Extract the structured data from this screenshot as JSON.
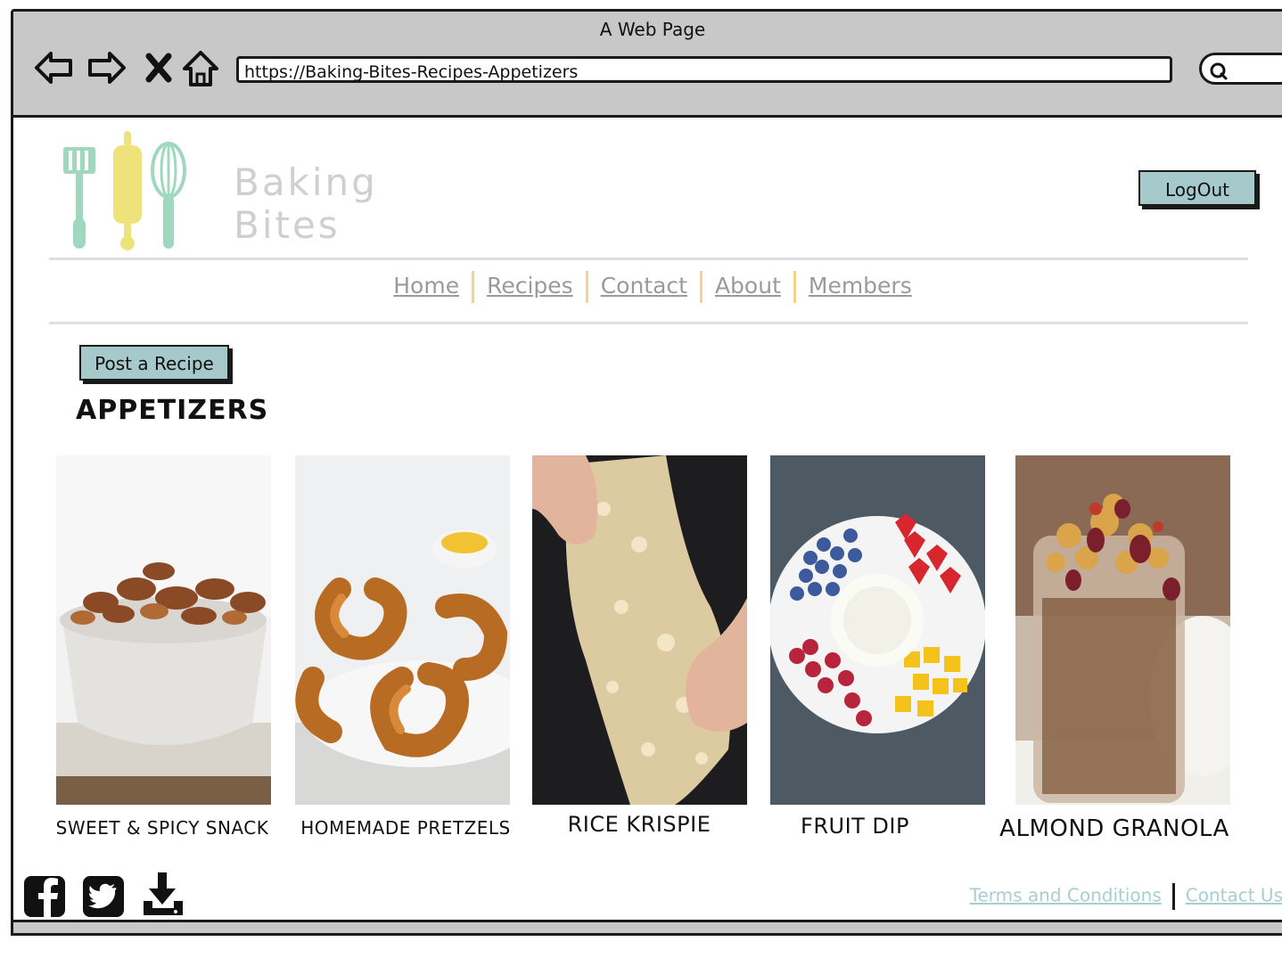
{
  "window": {
    "title": "A Web Page",
    "url": "https://Baking-Bites-Recipes-Appetizers"
  },
  "browser_icons": [
    "back-arrow-icon",
    "forward-arrow-icon",
    "close-icon",
    "home-icon",
    "search-icon"
  ],
  "logo": {
    "line1": "Baking",
    "line2": "Bites"
  },
  "header": {
    "logout_label": "LogOut"
  },
  "nav": {
    "items": [
      "Home",
      "Recipes",
      "Contact",
      "About",
      "Members"
    ]
  },
  "actions": {
    "post_label": "Post a Recipe"
  },
  "section": {
    "title": "APPETIZERS"
  },
  "recipes": [
    {
      "name": "SWEET & SPICY SNACK"
    },
    {
      "name": "HOMEMADE PRETZELS"
    },
    {
      "name": "RICE KRISPIE"
    },
    {
      "name": "FRUIT DIP"
    },
    {
      "name": "ALMOND GRANOLA"
    }
  ],
  "footer": {
    "icons": [
      "facebook-icon",
      "twitter-icon",
      "download-icon"
    ],
    "terms_label": "Terms and Conditions",
    "contact_label": "Contact Us"
  },
  "colors": {
    "button_fill": "#a6c9cc",
    "nav_link": "#9a9a9a",
    "nav_separator": "#f4d488",
    "footer_link": "#a8cfd0",
    "chrome": "#c8c8c8"
  }
}
